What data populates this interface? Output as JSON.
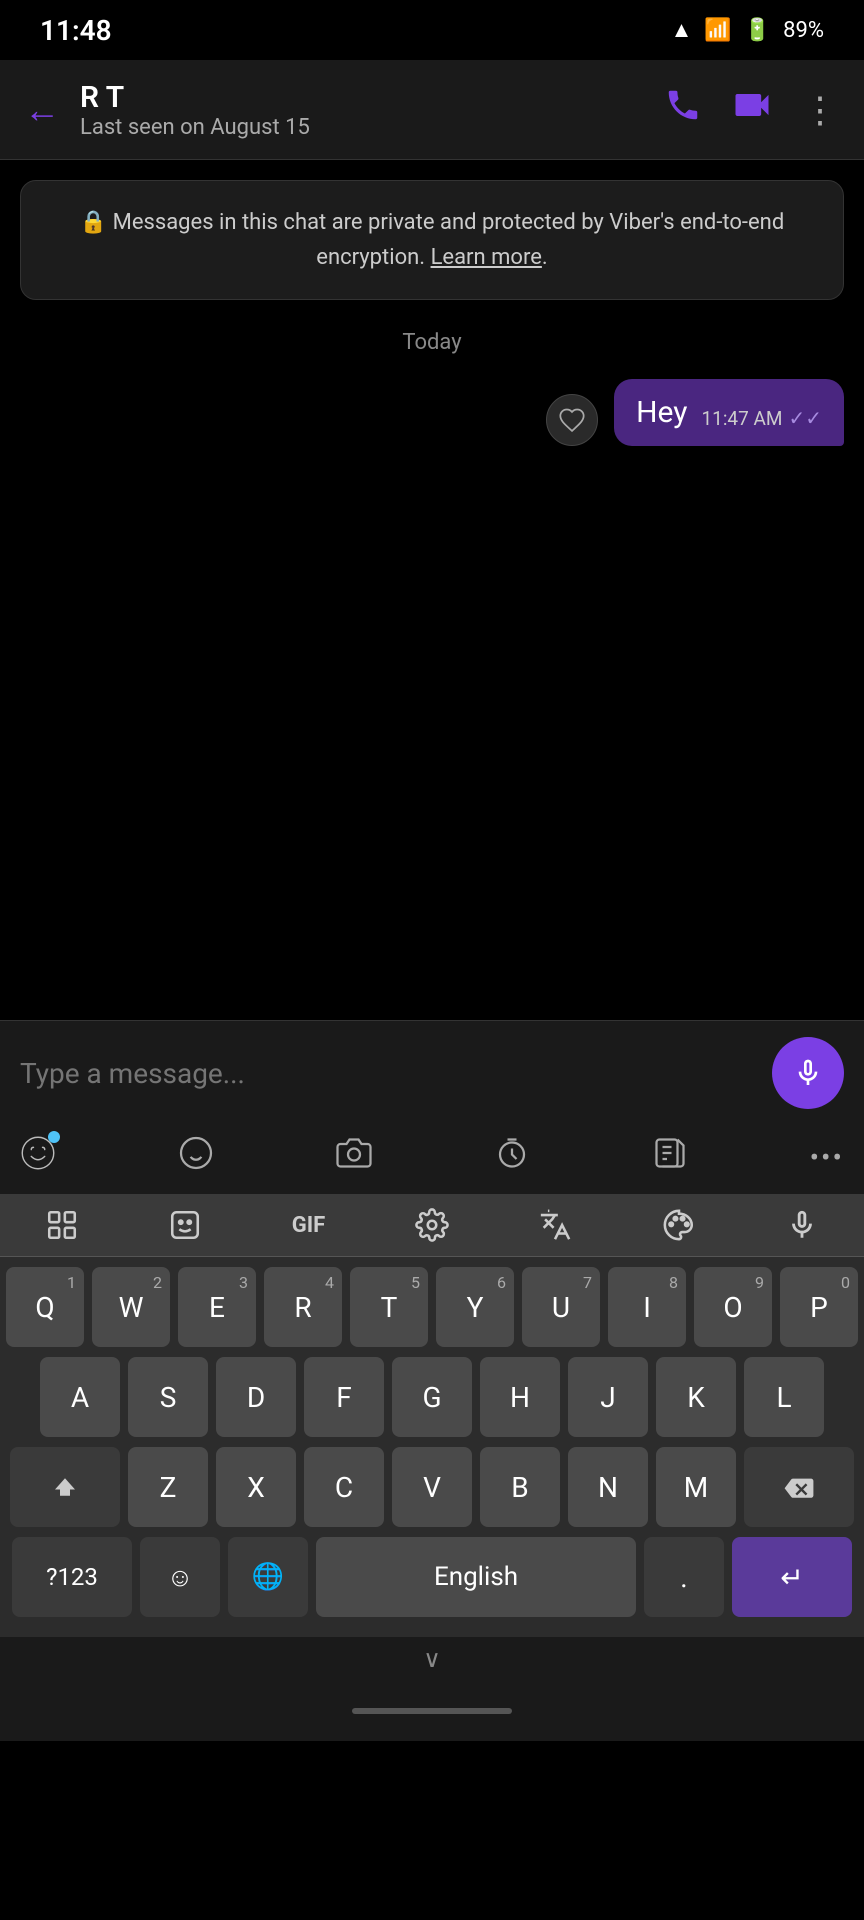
{
  "statusBar": {
    "time": "11:48",
    "battery": "89%"
  },
  "header": {
    "contactName": "R T",
    "contactStatus": "Last seen on August 15",
    "backLabel": "←",
    "callLabel": "📞",
    "videoLabel": "📹",
    "moreLabel": "⋮"
  },
  "chat": {
    "encryptionNotice": "Messages in this chat are private and protected by Viber's end-to-end encryption.",
    "learnMore": "Learn more",
    "dateDivider": "Today",
    "messages": [
      {
        "text": "Hey",
        "time": "11:47 AM",
        "delivered": true
      }
    ]
  },
  "inputArea": {
    "placeholder": "Type a message...",
    "micIcon": "🎤"
  },
  "inputToolbar": {
    "emojiIcon": "😺",
    "stickerIcon": "🖼",
    "cameraIcon": "📷",
    "timerIcon": "⏱",
    "noteIcon": "📋",
    "moreIcon": "•••"
  },
  "keyboard": {
    "toolbarIcons": [
      "⊞",
      "☺",
      "GIF",
      "⚙",
      "G↔",
      "🎨",
      "🎤"
    ],
    "row1": [
      "Q",
      "W",
      "E",
      "R",
      "T",
      "Y",
      "U",
      "I",
      "O",
      "P"
    ],
    "row1nums": [
      "1",
      "2",
      "3",
      "4",
      "5",
      "6",
      "7",
      "8",
      "9",
      "0"
    ],
    "row2": [
      "A",
      "S",
      "D",
      "F",
      "G",
      "H",
      "J",
      "K",
      "L"
    ],
    "row3": [
      "Z",
      "X",
      "C",
      "V",
      "B",
      "N",
      "M"
    ],
    "shiftLabel": "⬆",
    "backspaceLabel": "⌫",
    "num123Label": "?123",
    "emojiLabel": "☺",
    "globeLabel": "🌐",
    "spaceLabel": "English",
    "periodLabel": ".",
    "enterLabel": "↵"
  },
  "collapseLabel": "∨",
  "bottomIndicator": ""
}
